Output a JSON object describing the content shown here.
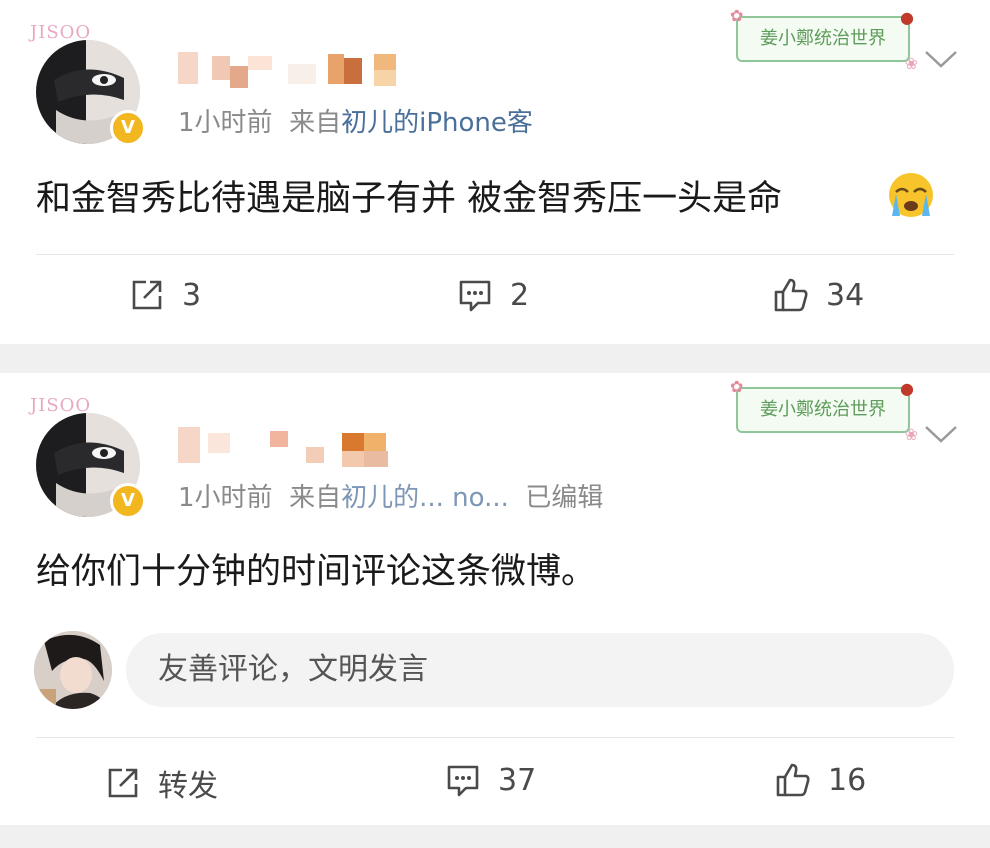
{
  "posts": [
    {
      "pendant_text": "JISOO",
      "badge_text": "姜小鄭统治世界",
      "verified_mark": "V",
      "time": "1小时前",
      "from_prefix": "来自",
      "source": "初儿的iPhone客",
      "edited": "",
      "content": "和金智秀比待遇是脑子有并 被金智秀压一头是命",
      "emoji": "crying-face-emoji",
      "actions": {
        "repost": "3",
        "comment": "2",
        "like": "34"
      }
    },
    {
      "pendant_text": "JISOO",
      "badge_text": "姜小鄭统治世界",
      "verified_mark": "V",
      "time": "1小时前",
      "from_prefix": "来自",
      "source": "初儿的... no...",
      "edited": "已编辑",
      "content": "给你们十分钟的时间评论这条微博。",
      "comment_placeholder": "友善评论，文明发言",
      "actions": {
        "repost": "转发",
        "comment": "37",
        "like": "16"
      }
    }
  ],
  "icons": [
    "share-icon",
    "comment-icon",
    "like-icon",
    "chevron-down-icon"
  ],
  "colors": {
    "background": "#f0f0f0",
    "card": "#ffffff",
    "source_link": "#4a6f9a",
    "meta_gray": "#8a8a8a",
    "verified": "#f2b61f",
    "badge_green": "#8fc79a"
  }
}
